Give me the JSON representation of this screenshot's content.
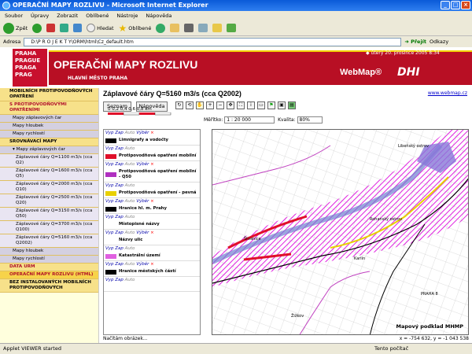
{
  "window": {
    "title": "OPERAČNÍ MAPY ROZLIVU - Microsoft Internet Explorer"
  },
  "menu": [
    "Soubor",
    "Úpravy",
    "Zobrazit",
    "Oblíbené",
    "Nástroje",
    "Nápověda"
  ],
  "toolbar": {
    "back": "Zpět",
    "search": "Hledat",
    "favorites": "Oblíbené"
  },
  "address": {
    "label": "Adresa",
    "value": "D:\\P R O J E K T Y\\ORM\\html\\Cz_default.htm",
    "go": "Přejít",
    "links": "Odkazy"
  },
  "banner": {
    "praha": [
      "PRAHA",
      "PRAGUE",
      "PRAGA",
      "PRAG"
    ],
    "title": "OPERAČNÍ MAPY ROZLIVU",
    "subtitle": "HLAVNÍ MĚSTO PRAHA",
    "date": "úterý 20. prosince 2005 8:34",
    "webmap": "WebMap®",
    "dhi": "DHI"
  },
  "sidebar": [
    {
      "text": "MOBILNÍCH PROTIPOVODŇOVÝCH OPATŘENÍ",
      "cls": ""
    },
    {
      "text": "S PROTIPOVODŇOVÝMI OPATŘENÍMI",
      "cls": "sb-red"
    },
    {
      "text": "Mapy záplavových čar",
      "cls": "sub"
    },
    {
      "text": "Mapy hloubek",
      "cls": "sub"
    },
    {
      "text": "Mapy rychlostí",
      "cls": "sub"
    },
    {
      "text": "SROVNÁVACÍ MAPY",
      "cls": ""
    },
    {
      "text": "▾ Mapy záplavových čar",
      "cls": "sub"
    },
    {
      "text": "Záplavové čáry Q=1100 m3/s (cca Q2)",
      "cls": "sub2"
    },
    {
      "text": "Záplavové čáry Q=1600 m3/s (cca Q5)",
      "cls": "sub2"
    },
    {
      "text": "Záplavové čáry Q=2000 m3/s (cca Q10)",
      "cls": "sub2"
    },
    {
      "text": "Záplavové čáry Q=2500 m3/s (cca Q20)",
      "cls": "sub2"
    },
    {
      "text": "Záplavové čáry Q=3150 m3/s (cca Q50)",
      "cls": "sub2"
    },
    {
      "text": "Záplavové čáry Q=3700 m3/s (cca Q100)",
      "cls": "sub2"
    },
    {
      "text": "Záplavové čáry Q=5160 m3/s (cca Q2002)",
      "cls": "sub2"
    },
    {
      "text": "Mapy hloubek",
      "cls": "sub"
    },
    {
      "text": "Mapy rychlostí",
      "cls": "sub"
    },
    {
      "text": "DATA URM",
      "cls": "sb-red"
    },
    {
      "text": "OPERAČNÍ MAPY ROZLIVU (HTML)",
      "cls": "hl"
    },
    {
      "text": "BEZ INSTALOVANÝCH MOBILNÍCH PROTIPOVODŇOVÝCH",
      "cls": ""
    }
  ],
  "main": {
    "title": "Záplavové čáry  Q=5160 m3/s (cca Q2002)",
    "link": "www.webmap.cz",
    "btn_seznam": "Seznam",
    "btn_napoveda": "Nápověda",
    "scale": "0  0,2  0,4  0,6  0,8 km",
    "meritko_label": "Měřítko:",
    "meritko": "1 : 20 000",
    "kvalita_label": "Kvalita:",
    "kvalita": "80%",
    "loading": "Načítám obrázek...",
    "coords": "x = -754 632, y = -1 043 538",
    "map_caption": "Mapový podklad MHMP"
  },
  "legend": [
    {
      "hdr": "Vyp Zap Auto Výběr",
      "label": "Limnigrafy a vodočty",
      "color": "#000"
    },
    {
      "hdr": "Vyp Zap Auto",
      "label": "Protipovodňová opatření mobilní",
      "color": "#e0102a"
    },
    {
      "hdr": "Vyp Zap Auto Výběr",
      "label": "Protipovodňová opatření mobilní - Q50",
      "color": "#b030c0"
    },
    {
      "hdr": "Vyp Zap Auto",
      "label": "Protipovodňová opatření - pevná",
      "color": "#e8d000"
    },
    {
      "hdr": "Vyp Zap Auto Výběr",
      "label": "Hranice hl. m. Prahy",
      "color": "#000"
    },
    {
      "hdr": "Vyp Zap Auto",
      "label": "Místopisné názvy",
      "color": "#fff"
    },
    {
      "hdr": "Vyp Zap Auto Výběr",
      "label": "Názvy ulic",
      "color": "#fff"
    },
    {
      "hdr": "Vyp Zap Auto",
      "label": "Katastrální území",
      "color": "#e060e0"
    },
    {
      "hdr": "Vyp Zap Auto Výběr",
      "label": "Hranice městských částí",
      "color": "#000"
    },
    {
      "hdr": "Vyp Zap Auto",
      "label": "",
      "color": "#fff"
    }
  ],
  "status": {
    "left": "Applet VIEWER started",
    "right": "Tento počítač"
  }
}
